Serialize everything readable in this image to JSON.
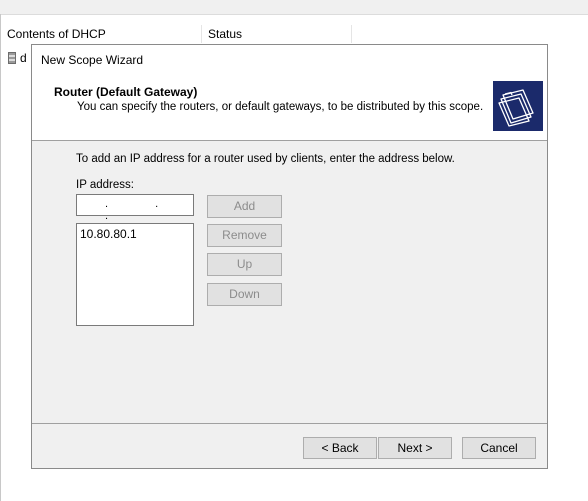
{
  "background": {
    "columns": [
      "Contents of DHCP",
      "Status"
    ],
    "row_text": "d"
  },
  "wizard": {
    "title": "New Scope Wizard",
    "header_title": "Router (Default Gateway)",
    "header_subtitle": "You can specify the routers, or default gateways, to be distributed by this scope.",
    "header_icon": "folders-icon",
    "instruction": "To add an IP address for a router used by clients, enter the address below.",
    "ip_label": "IP address:",
    "ip_value": ". . .",
    "routers": [
      "10.80.80.1"
    ],
    "buttons": {
      "add": "Add",
      "remove": "Remove",
      "up": "Up",
      "down": "Down"
    },
    "footer": {
      "back": "< Back",
      "next": "Next >",
      "cancel": "Cancel"
    },
    "colors": {
      "icon_bg": "#1b2a6b",
      "dialog_bg": "#f0f0f0",
      "disabled_text": "#8c8c8c"
    }
  }
}
